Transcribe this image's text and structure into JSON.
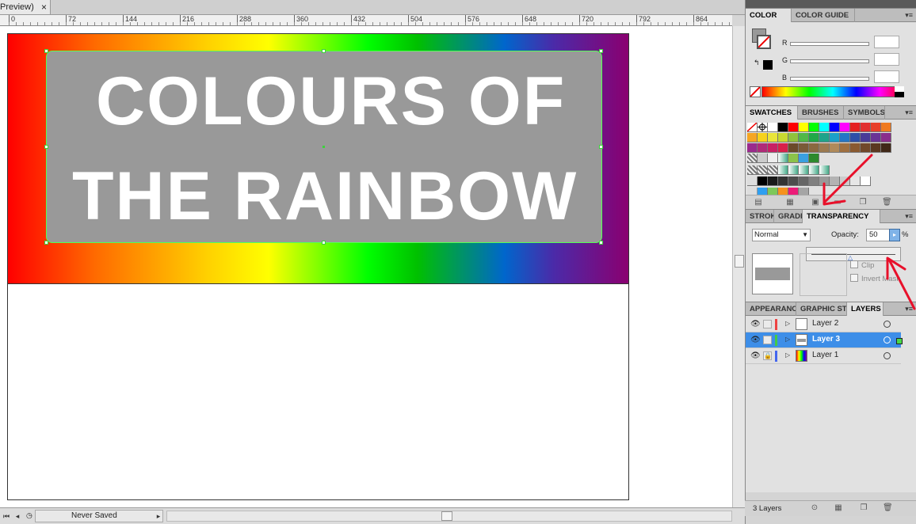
{
  "document": {
    "tab_title": "Preview)",
    "tab_close": "×",
    "ruler_labels": [
      "0",
      "72",
      "144",
      "216",
      "288",
      "360",
      "432",
      "504",
      "576",
      "648",
      "720",
      "792",
      "864"
    ],
    "headline_line1": "COLOURS OF",
    "headline_line2": "THE RAINBOW"
  },
  "status": {
    "text": "Never Saved"
  },
  "color_panel": {
    "tabs": [
      "COLOR",
      "COLOR GUIDE"
    ],
    "channels": [
      "R",
      "G",
      "B"
    ]
  },
  "swatches_panel": {
    "tabs": [
      "SWATCHES",
      "BRUSHES",
      "SYMBOLS"
    ]
  },
  "transparency_panel": {
    "tabs": [
      "STROK",
      "GRADI",
      "TRANSPARENCY"
    ],
    "blend_mode": "Normal",
    "opacity_label": "Opacity:",
    "opacity_value": "50",
    "opacity_unit": "%",
    "clip_label": "Clip",
    "invert_mask_label": "Invert Mask"
  },
  "layers_panel": {
    "tabs": [
      "APPEARANC",
      "GRAPHIC ST",
      "LAYERS"
    ],
    "layers": [
      {
        "name": "Layer 2",
        "color": "#ee4444",
        "selected": false
      },
      {
        "name": "Layer 3",
        "color": "#44cc44",
        "selected": true
      },
      {
        "name": "Layer 1",
        "color": "#4466ee",
        "selected": false
      }
    ],
    "count_text": "3 Layers"
  },
  "colors": {
    "selection": "#3d8ee8",
    "bounding_box": "#55ff55",
    "text_fill": "#999999",
    "annotation_arrow": "#e8102a"
  }
}
